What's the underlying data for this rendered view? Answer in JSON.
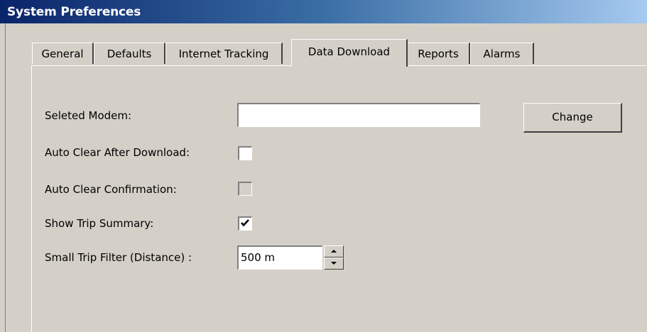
{
  "window": {
    "title": "System Preferences"
  },
  "tabs": [
    {
      "label": "General"
    },
    {
      "label": "Defaults"
    },
    {
      "label": "Internet Tracking"
    },
    {
      "label": "Data Download",
      "active": true
    },
    {
      "label": "Reports"
    },
    {
      "label": "Alarms"
    }
  ],
  "form": {
    "modem_label": "Seleted Modem:",
    "modem_value": "",
    "change_button": "Change",
    "auto_clear_label": "Auto Clear After Download:",
    "auto_clear_checked": false,
    "auto_clear_confirm_label": "Auto Clear Confirmation:",
    "auto_clear_confirm_checked": false,
    "auto_clear_confirm_enabled": false,
    "show_trip_label": "Show Trip Summary:",
    "show_trip_checked": true,
    "small_trip_label": "Small Trip Filter (Distance) :",
    "small_trip_value": "500 m"
  },
  "icons": {
    "check": "check-mark-icon",
    "spin_up": "triangle-up-icon",
    "spin_down": "triangle-down-icon"
  },
  "colors": {
    "face": "#d4d0c8",
    "title_start": "#0a246a",
    "title_end": "#a6caf0"
  }
}
